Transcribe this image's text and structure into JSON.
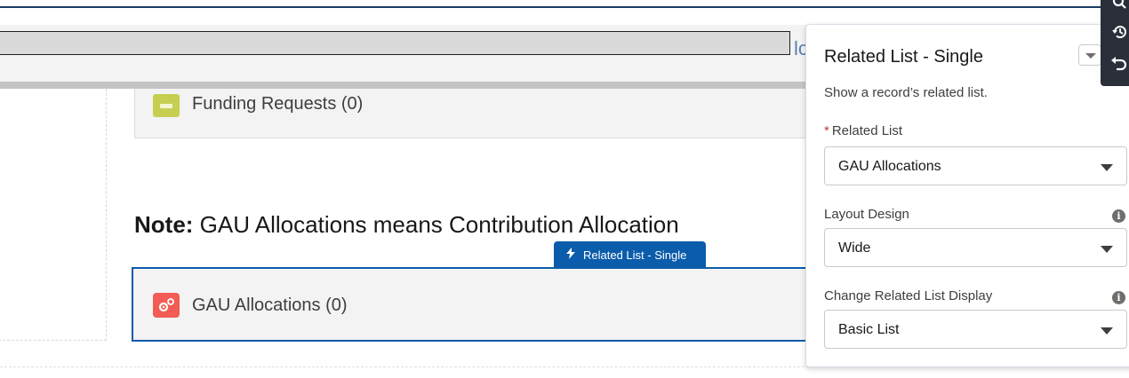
{
  "peek_text": "lc",
  "funding_card": {
    "label": "Funding Requests (0)",
    "icon": "archive-icon"
  },
  "note": {
    "bold": "Note:",
    "text": " GAU Allocations means Contribution Allocation"
  },
  "component_tag": {
    "label": "Related List - Single",
    "icon": "lightning-bolt-icon"
  },
  "gau_card": {
    "label": "GAU Allocations (0)",
    "icon": "gears-icon"
  },
  "popover": {
    "title": "Related List - Single",
    "description": "Show a record’s related list.",
    "fields": [
      {
        "label": "Related List",
        "required": "*",
        "value": "GAU Allocations"
      },
      {
        "label": "Layout Design",
        "value": "Wide",
        "info": "i"
      },
      {
        "label": "Change Related List Display",
        "value": "Basic List",
        "info": "i"
      }
    ]
  },
  "toolbar": {
    "icons": [
      "search-icon",
      "history-icon",
      "undo-icon"
    ]
  },
  "colors": {
    "accent": "#0b5cab",
    "funding_icon": "#c6cf52",
    "gau_icon": "#f25c54",
    "required": "#c23934",
    "toolbar_bg": "#2a2f3a"
  }
}
